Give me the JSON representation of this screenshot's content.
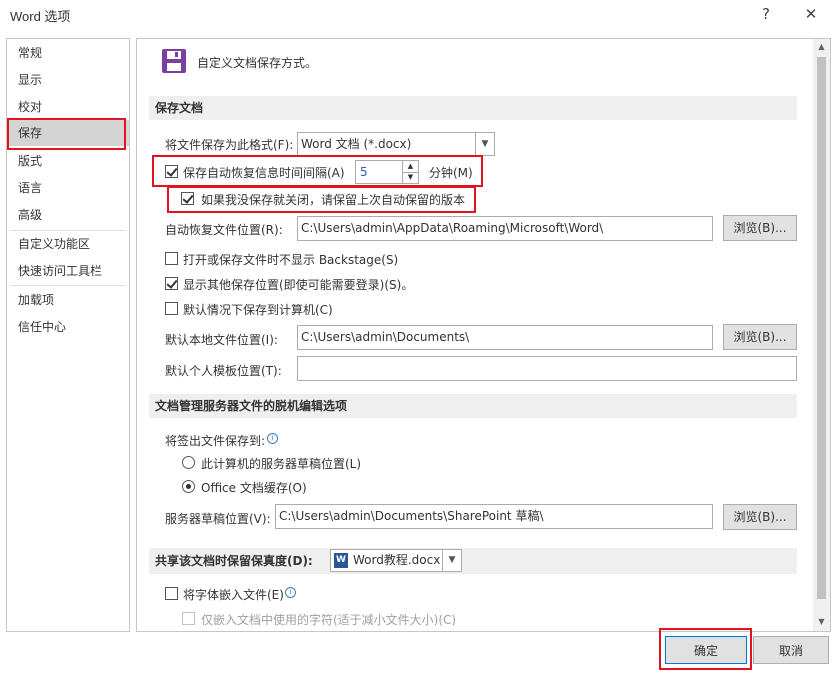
{
  "window": {
    "title": "Word 选项",
    "help": "?",
    "close": "✕"
  },
  "sidebar": {
    "items": [
      {
        "label": "常规"
      },
      {
        "label": "显示"
      },
      {
        "label": "校对"
      },
      {
        "label": "保存"
      },
      {
        "label": "版式"
      },
      {
        "label": "语言"
      },
      {
        "label": "高级"
      },
      {
        "label": "自定义功能区"
      },
      {
        "label": "快速访问工具栏"
      },
      {
        "label": "加载项"
      },
      {
        "label": "信任中心"
      }
    ],
    "selected": "保存"
  },
  "header": {
    "icon": "save-disk-icon",
    "text": "自定义文档保存方式。"
  },
  "save_section": {
    "title": "保存文档",
    "format_label": "将文件保存为此格式(F):",
    "format_value": "Word 文档 (*.docx)",
    "autorecover_label": "保存自动恢复信息时间间隔(A)",
    "autorecover_checked": true,
    "autorecover_minutes": "5",
    "minutes_label": "分钟(M)",
    "keep_last_label": "如果我没保存就关闭，请保留上次自动保留的版本",
    "keep_last_checked": true,
    "autorecover_location_label": "自动恢复文件位置(R):",
    "autorecover_location_value": "C:\\Users\\admin\\AppData\\Roaming\\Microsoft\\Word\\",
    "browse_label": "浏览(B)...",
    "no_backstage_label": "打开或保存文件时不显示 Backstage(S)",
    "no_backstage_checked": false,
    "show_other_locations_label": "显示其他保存位置(即使可能需要登录)(S)。",
    "show_other_locations_checked": true,
    "default_to_computer_label": "默认情况下保存到计算机(C)",
    "default_to_computer_checked": false,
    "default_local_label": "默认本地文件位置(I):",
    "default_local_value": "C:\\Users\\admin\\Documents\\",
    "default_template_label": "默认个人模板位置(T):",
    "default_template_value": ""
  },
  "offline_section": {
    "title": "文档管理服务器文件的脱机编辑选项",
    "checkout_label": "将签出文件保存到:",
    "option_server_drafts": "此计算机的服务器草稿位置(L)",
    "option_office_cache": "Office 文档缓存(O)",
    "selected_option": "Office 文档缓存(O)",
    "drafts_location_label": "服务器草稿位置(V):",
    "drafts_location_value": "C:\\Users\\admin\\Documents\\SharePoint 草稿\\",
    "browse_label": "浏览(B)..."
  },
  "fidelity_section": {
    "title": "共享该文档时保留保真度(D):",
    "document_value": "Word教程.docx",
    "embed_fonts_label": "将字体嵌入文件(E)",
    "embed_fonts_checked": false,
    "embed_used_chars_label": "仅嵌入文档中使用的字符(适于减小文件大小)(C)",
    "embed_used_chars_checked": false
  },
  "footer": {
    "ok": "确定",
    "cancel": "取消"
  },
  "colors": {
    "highlight_red": "#e0131f",
    "save_icon": "#7b3fa0",
    "section_bg": "#efefef",
    "selected_nav": "#d4d4d4"
  }
}
